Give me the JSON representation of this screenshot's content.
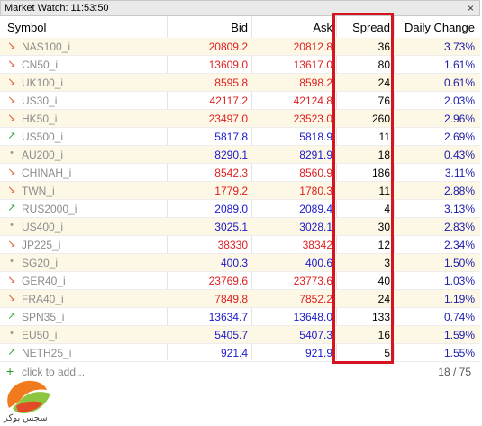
{
  "window": {
    "title": "Market Watch: 11:53:50",
    "close_glyph": "×"
  },
  "columns": {
    "symbol": "Symbol",
    "bid": "Bid",
    "ask": "Ask",
    "spread": "Spread",
    "change": "Daily Change"
  },
  "rows": [
    {
      "symbol": "NAS100_i",
      "icon": "arrow-down",
      "bid": "20809.2",
      "ask": "20812.8",
      "spread": "36",
      "change": "3.73%",
      "color": "red"
    },
    {
      "symbol": "CN50_i",
      "icon": "arrow-down",
      "bid": "13609.0",
      "ask": "13617.0",
      "spread": "80",
      "change": "1.61%",
      "color": "red"
    },
    {
      "symbol": "UK100_i",
      "icon": "arrow-down",
      "bid": "8595.8",
      "ask": "8598.2",
      "spread": "24",
      "change": "0.61%",
      "color": "red"
    },
    {
      "symbol": "US30_i",
      "icon": "arrow-down",
      "bid": "42117.2",
      "ask": "42124.8",
      "spread": "76",
      "change": "2.03%",
      "color": "red"
    },
    {
      "symbol": "HK50_i",
      "icon": "arrow-down",
      "bid": "23497.0",
      "ask": "23523.0",
      "spread": "260",
      "change": "2.96%",
      "color": "red"
    },
    {
      "symbol": "US500_i",
      "icon": "arrow-up",
      "bid": "5817.8",
      "ask": "5818.9",
      "spread": "11",
      "change": "2.69%",
      "color": "blue"
    },
    {
      "symbol": "AU200_i",
      "icon": "dot",
      "bid": "8290.1",
      "ask": "8291.9",
      "spread": "18",
      "change": "0.43%",
      "color": "blue"
    },
    {
      "symbol": "CHINAH_i",
      "icon": "arrow-down",
      "bid": "8542.3",
      "ask": "8560.9",
      "spread": "186",
      "change": "3.11%",
      "color": "red"
    },
    {
      "symbol": "TWN_i",
      "icon": "arrow-down",
      "bid": "1779.2",
      "ask": "1780.3",
      "spread": "11",
      "change": "2.88%",
      "color": "red"
    },
    {
      "symbol": "RUS2000_i",
      "icon": "arrow-up",
      "bid": "2089.0",
      "ask": "2089.4",
      "spread": "4",
      "change": "3.13%",
      "color": "blue"
    },
    {
      "symbol": "US400_i",
      "icon": "dot",
      "bid": "3025.1",
      "ask": "3028.1",
      "spread": "30",
      "change": "2.83%",
      "color": "blue"
    },
    {
      "symbol": "JP225_i",
      "icon": "arrow-down",
      "bid": "38330",
      "ask": "38342",
      "spread": "12",
      "change": "2.34%",
      "color": "red"
    },
    {
      "symbol": "SG20_i",
      "icon": "dot",
      "bid": "400.3",
      "ask": "400.6",
      "spread": "3",
      "change": "1.50%",
      "color": "blue"
    },
    {
      "symbol": "GER40_i",
      "icon": "arrow-down",
      "bid": "23769.6",
      "ask": "23773.6",
      "spread": "40",
      "change": "1.03%",
      "color": "red"
    },
    {
      "symbol": "FRA40_i",
      "icon": "arrow-down",
      "bid": "7849.8",
      "ask": "7852.2",
      "spread": "24",
      "change": "1.19%",
      "color": "red"
    },
    {
      "symbol": "SPN35_i",
      "icon": "arrow-up",
      "bid": "13634.7",
      "ask": "13648.0",
      "spread": "133",
      "change": "0.74%",
      "color": "blue"
    },
    {
      "symbol": "EU50_i",
      "icon": "dot",
      "bid": "5405.7",
      "ask": "5407.3",
      "spread": "16",
      "change": "1.59%",
      "color": "blue"
    },
    {
      "symbol": "NETH25_i",
      "icon": "arrow-up",
      "bid": "921.4",
      "ask": "921.9",
      "spread": "5",
      "change": "1.55%",
      "color": "blue"
    }
  ],
  "footer": {
    "add_label": "click to add...",
    "count": "18 / 75"
  },
  "logo": {
    "text": "سچس پوکر"
  },
  "icons": {
    "arrow-down": "↘",
    "arrow-up": "↗",
    "dot": "•"
  },
  "colors": {
    "highlight": "#d4141e",
    "red": "#e02020",
    "blue": "#1a1acc"
  }
}
